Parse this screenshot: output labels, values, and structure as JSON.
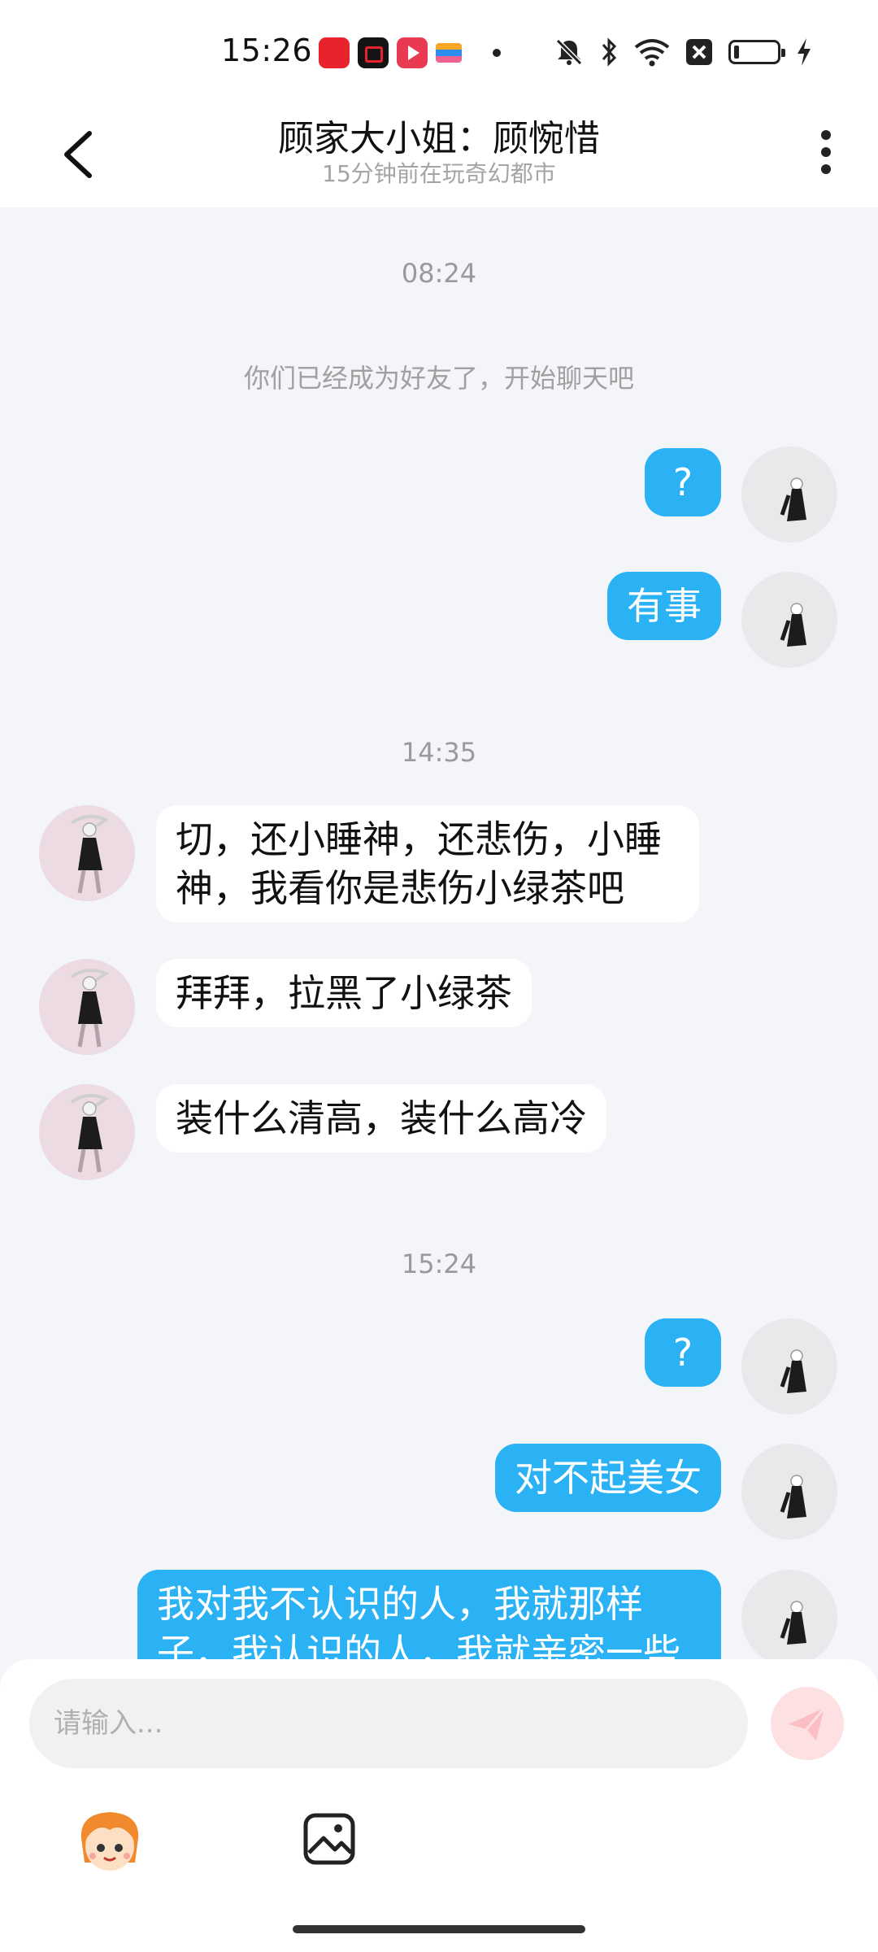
{
  "status_bar": {
    "time": "15:26",
    "notification_icons": [
      "app-icon-red",
      "screen-record-icon",
      "video-app-icon",
      "multicolor-app-icon",
      "dot-icon"
    ],
    "system_icons": [
      "mute-icon",
      "bluetooth-icon",
      "wifi-icon",
      "sim-off-icon",
      "battery-icon",
      "charging-icon"
    ]
  },
  "header": {
    "title": "顾家大小姐：顾惋惜",
    "subtitle": "15分钟前在玩奇幻都市"
  },
  "chat": {
    "time_1": "08:24",
    "system_message": "你们已经成为好友了，开始聊天吧",
    "msg_out_1": "?",
    "msg_out_2": "有事",
    "time_2": "14:35",
    "msg_in_1_line1": "切，还小睡神，还悲伤，小睡",
    "msg_in_1_line2": "神，我看你是悲伤小绿茶吧",
    "msg_in_2": "拜拜，拉黑了小绿茶",
    "msg_in_3": "装什么清高，装什么高冷",
    "time_3": "15:24",
    "msg_out_3": "?",
    "msg_out_4": "对不起美女",
    "msg_out_5_line1": "我对我不认识的人，我就那样",
    "msg_out_5_line2": "子，我认识的人，我就亲密一些"
  },
  "input": {
    "placeholder": "请输入..."
  },
  "colors": {
    "outgoing_bubble": "#2bb2f5",
    "incoming_bubble": "#ffffff",
    "chat_background": "#f3f5f8",
    "send_button": "#fde1e2"
  }
}
